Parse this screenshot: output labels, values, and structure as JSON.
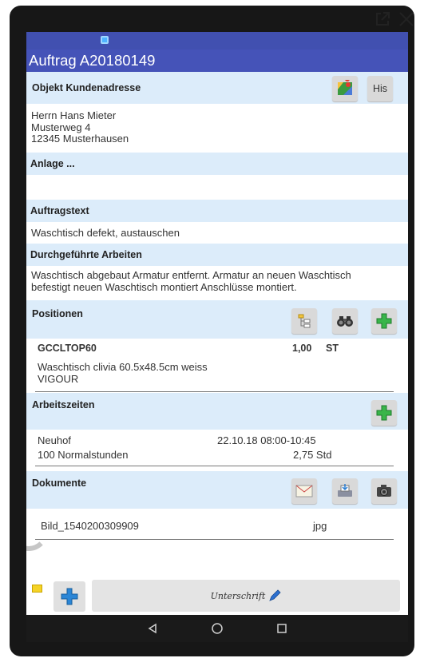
{
  "window_controls": {
    "open_external_icon": "external-link-icon",
    "close_icon": "close-icon"
  },
  "title": "Auftrag A20180149",
  "objekt": {
    "header": "Objekt Kundenadresse",
    "map_icon": "map-icon",
    "his_label": "His",
    "address": [
      "Herrn Hans Mieter",
      "Musterweg 4",
      "12345 Musterhausen"
    ]
  },
  "anlage": {
    "header": "Anlage ..."
  },
  "auftragstext": {
    "header": "Auftragstext",
    "text": "Waschtisch defekt, austauschen"
  },
  "arbeiten": {
    "header": "Durchgeführte Arbeiten",
    "lines": [
      "Waschtisch abgebaut Armatur entfernt. Armatur an neuen Waschtisch",
      "befestigt neuen Waschtisch montiert Anschlüsse montiert."
    ]
  },
  "positionen": {
    "header": "Positionen",
    "items": [
      {
        "code": "GCCLTOP60",
        "qty": "1,00",
        "unit": "ST",
        "desc1": "Waschtisch clivia 60.5x48.5cm weiss",
        "desc2": "VIGOUR"
      }
    ]
  },
  "arbeitszeiten": {
    "header": "Arbeitszeiten",
    "rows": [
      {
        "name": "Neuhof",
        "value": "22.10.18 08:00-10:45"
      },
      {
        "name": "100 Normalstunden",
        "value": "2,75 Std"
      }
    ]
  },
  "dokumente": {
    "header": "Dokumente",
    "items": [
      {
        "name": "Bild_1540200309909",
        "ext": "jpg"
      }
    ]
  },
  "bottom": {
    "signature_label": "Unterschrift"
  },
  "colors": {
    "header_blue": "#4553b8",
    "section_bg": "#dcecfa",
    "add_green": "#39b54a"
  }
}
